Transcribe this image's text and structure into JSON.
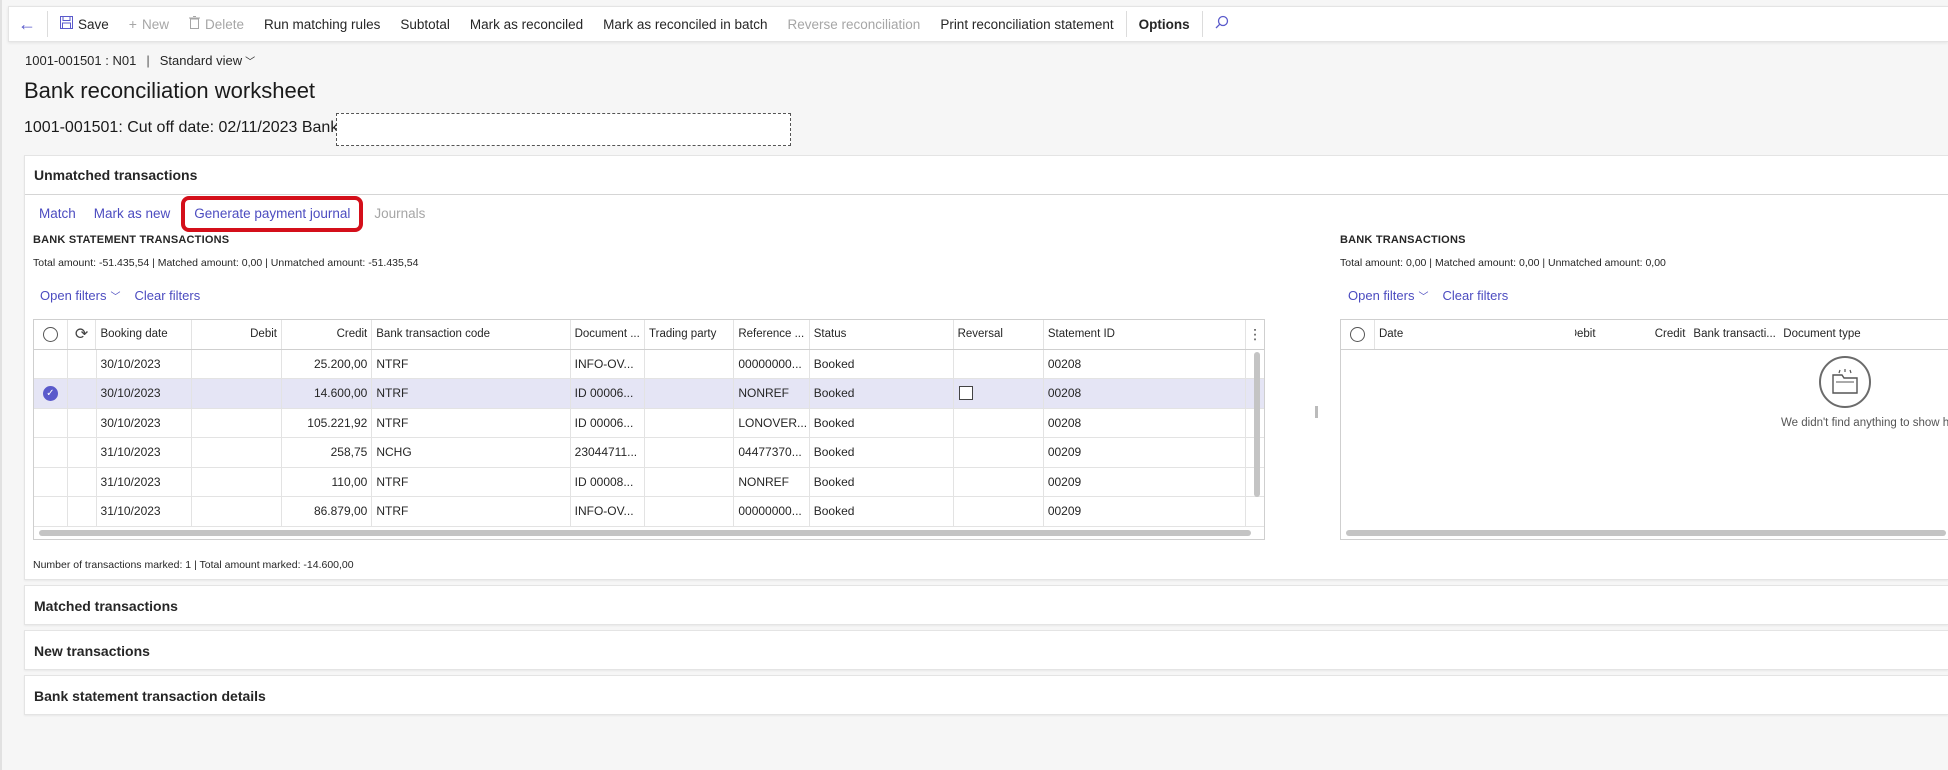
{
  "toolbar": {
    "save": "Save",
    "new": "New",
    "delete": "Delete",
    "run_matching_rules": "Run matching rules",
    "subtotal": "Subtotal",
    "mark_as_reconciled": "Mark as reconciled",
    "mark_as_reconciled_batch": "Mark as reconciled in batch",
    "reverse_reconciliation": "Reverse reconciliation",
    "print_statement": "Print reconciliation statement",
    "options": "Options"
  },
  "header": {
    "record": "1001-001501 : N01",
    "separator": "|",
    "view": "Standard view",
    "title": "Bank reconciliation worksheet",
    "subtitle": "1001-001501: Cut off date: 02/11/2023 Bank",
    "bank_value": ""
  },
  "unmatched": {
    "title": "Unmatched transactions",
    "actions": {
      "match": "Match",
      "mark_as_new": "Mark as new",
      "generate_payment_journal": "Generate payment journal",
      "journals": "Journals"
    },
    "statement": {
      "title": "BANK STATEMENT TRANSACTIONS",
      "totals": "Total amount: -51.435,54 | Matched amount: 0,00 | Unmatched amount: -51.435,54",
      "open_filters": "Open filters",
      "clear_filters": "Clear filters",
      "columns": [
        "Booking date",
        "Debit",
        "Credit",
        "Bank transaction code",
        "Document ...",
        "Trading party",
        "Reference ...",
        "Status",
        "Reversal",
        "Statement ID"
      ],
      "rows": [
        {
          "date": "30/10/2023",
          "debit": "",
          "credit": "25.200,00",
          "code": "NTRF",
          "doc": "INFO-OV...",
          "party": "",
          "ref": "00000000...",
          "status": "Booked",
          "reversal": false,
          "statement": "00208",
          "selected": false
        },
        {
          "date": "30/10/2023",
          "debit": "",
          "credit": "14.600,00",
          "code": "NTRF",
          "doc": "ID 00006...",
          "party": "",
          "ref": "NONREF",
          "status": "Booked",
          "reversal": true,
          "statement": "00208",
          "selected": true
        },
        {
          "date": "30/10/2023",
          "debit": "",
          "credit": "105.221,92",
          "code": "NTRF",
          "doc": "ID 00006...",
          "party": "",
          "ref": "LONOVER...",
          "status": "Booked",
          "reversal": false,
          "statement": "00208",
          "selected": false
        },
        {
          "date": "31/10/2023",
          "debit": "",
          "credit": "258,75",
          "code": "NCHG",
          "doc": "23044711...",
          "party": "",
          "ref": "04477370...",
          "status": "Booked",
          "reversal": false,
          "statement": "00209",
          "selected": false
        },
        {
          "date": "31/10/2023",
          "debit": "",
          "credit": "110,00",
          "code": "NTRF",
          "doc": "ID 00008...",
          "party": "",
          "ref": "NONREF",
          "status": "Booked",
          "reversal": false,
          "statement": "00209",
          "selected": false
        },
        {
          "date": "31/10/2023",
          "debit": "",
          "credit": "86.879,00",
          "code": "NTRF",
          "doc": "INFO-OV...",
          "party": "",
          "ref": "00000000...",
          "status": "Booked",
          "reversal": false,
          "statement": "00209",
          "selected": false
        }
      ],
      "marked_summary": "Number of transactions marked: 1 | Total amount marked: -14.600,00"
    },
    "bank": {
      "title": "BANK TRANSACTIONS",
      "totals": "Total amount: 0,00 | Matched amount: 0,00 | Unmatched amount: 0,00",
      "open_filters": "Open filters",
      "clear_filters": "Clear filters",
      "columns": [
        "Date",
        "Debit",
        "Credit",
        "Bank transacti...",
        "Document type"
      ],
      "empty_text": "We didn't find anything to show he"
    }
  },
  "sections": {
    "matched": "Matched transactions",
    "new": "New transactions",
    "details": "Bank statement transaction details"
  }
}
